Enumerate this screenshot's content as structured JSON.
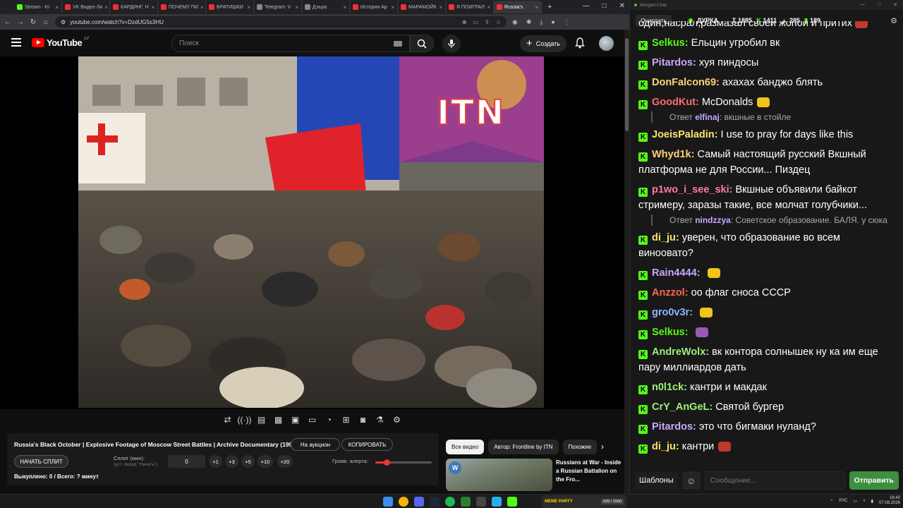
{
  "browser": {
    "tabs": [
      {
        "label": "Stream - Ki",
        "color": "#53fc18"
      },
      {
        "label": "VK Видео Ли",
        "color": "#e33"
      },
      {
        "label": "КАРДИНГ, Н",
        "color": "#e33"
      },
      {
        "label": "ПОЧЕМУ ПИ",
        "color": "#e33"
      },
      {
        "label": "БРАТИШКИ",
        "color": "#e33"
      },
      {
        "label": "Telegram: V",
        "color": "#888"
      },
      {
        "label": "Дзъра",
        "color": "#888"
      },
      {
        "label": "История Ар",
        "color": "#e33"
      },
      {
        "label": "МАРАМОЙК",
        "color": "#e33"
      },
      {
        "label": "Я ПОИГРАЛ",
        "color": "#e33"
      },
      {
        "label": "Russia's",
        "color": "#e33",
        "active": true
      }
    ],
    "url": "youtube.com/watch?v=DzdUG5s3HU"
  },
  "youtube": {
    "logo_text": "YouTube",
    "country_code": "LV",
    "search_placeholder": "Поиск",
    "create_label": "Создать",
    "video_overlay_logo": "ITN"
  },
  "extension": {
    "video_title": "Russia's Black October | Explosive Footage of Moscow Street Battles | Archive Documentary (1993)",
    "auction_label": "На аукцион",
    "copy_label": "КОПИРОВАТЬ",
    "start_split_label": "НАЧАТЬ СПЛИТ",
    "split_label": "Сплит (мин):",
    "split_sublabel": "(уст. перед \"Начать\")",
    "split_value": "0",
    "increments": [
      "+1",
      "+3",
      "+5",
      "+10",
      "+20"
    ],
    "alert_volume_label": "Громк. алерта:",
    "alert_volume_level": 0.2,
    "paid_text": "Выкуплено: 0 / Всего: ? минут"
  },
  "related": {
    "chips": [
      "Все видео",
      "Автор: Frontline by ITN",
      "Похожие"
    ],
    "video_title": "Russians at War - Inside a Russian Battalion on the Fro...",
    "badge": "W"
  },
  "chat": {
    "window_title": "Merged Chat",
    "clear_label": "Очистить",
    "streamer": "ДУРКА",
    "stats": {
      "total": "Σ 1885",
      "kick": "1411",
      "twitch": "285",
      "vk": "189"
    },
    "first_line": "один,насрал,размазал своеи жопои и притих",
    "messages": [
      {
        "user": "Selkus",
        "color": "#53fc18",
        "text": "Ельцин угробил вк"
      },
      {
        "user": "Pitardos",
        "color": "#c9a7ff",
        "text": "хуя пиндосы"
      },
      {
        "user": "DonFalcon69",
        "color": "#ffd27a",
        "text": "ахахах банджо блять"
      },
      {
        "user": "GoodKut",
        "color": "#ff6b6b",
        "text": "McDonalds",
        "reply_user": "elfinaj",
        "reply_text": "вкшные в стойле"
      },
      {
        "user": "JoeisPaladin",
        "color": "#ffe36e",
        "text": "I use to pray for days like this"
      },
      {
        "user": "Whyd1k",
        "color": "#ffd27a",
        "text": "Самый настоящий русский Вкшный платформа не для России... Пиздец"
      },
      {
        "user": "p1wo_i_see_ski",
        "color": "#ff7aa8",
        "text": "Вкшные объявили байкот стримеру, заразы такие, все молчат голубчики...",
        "reply_user": "nindzzya",
        "reply_text": "Советское образование. БАЛЯ. у сюка"
      },
      {
        "user": "di_ju",
        "color": "#ffe36e",
        "text": "уверен, что образование во всем виноовато?"
      },
      {
        "user": "Rain4444",
        "color": "#c9a7ff",
        "text": ""
      },
      {
        "user": "Anzzol",
        "color": "#ff6b4a",
        "text": "оо флаг сноса СССР"
      },
      {
        "user": "gro0v3r",
        "color": "#8fb7ff",
        "text": ""
      },
      {
        "user": "Selkus",
        "color": "#53fc18",
        "text": ""
      },
      {
        "user": "AndreWolx",
        "color": "#9ef07a",
        "text": "вк контора солнышек ну ка им еще пару миллиардов дать"
      },
      {
        "user": "n0l1ck",
        "color": "#9ef07a",
        "text": "кантри и макдак"
      },
      {
        "user": "CrY_AnGeL",
        "color": "#9ef07a",
        "text": "Святой бургер"
      },
      {
        "user": "Pitardos",
        "color": "#c9a7ff",
        "text": "это что бигмаки нуланд?"
      },
      {
        "user": "di_ju",
        "color": "#ffe36e",
        "text": "кантри"
      }
    ],
    "templates_label": "Шаблоны",
    "input_placeholder": "Сообщение...",
    "send_label": "Отправить"
  },
  "taskbar": {
    "widget_label": "MEME PARTY",
    "widget_value": "625 / 1500",
    "lang": "РУС",
    "time": "16:40",
    "date": "07.08.2026"
  }
}
